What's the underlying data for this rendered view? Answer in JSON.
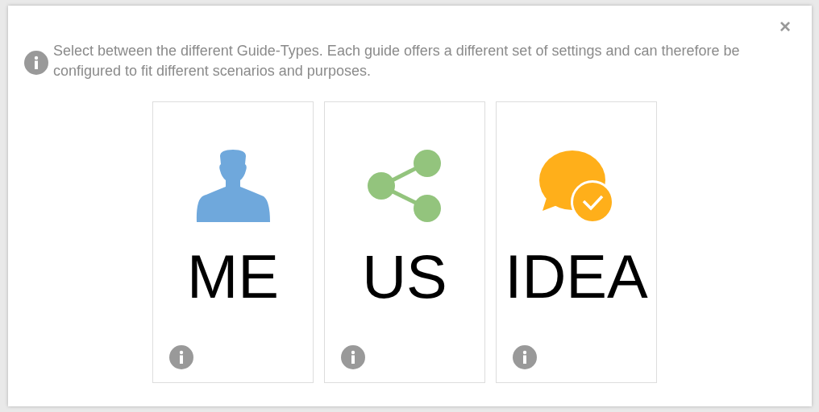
{
  "dialog": {
    "close": "×",
    "intro": "Select between the different Guide-Types. Each guide offers a different set of settings and can therefore be configured to fit different scenarios and purposes."
  },
  "guides": [
    {
      "kind": "person",
      "label": "ME"
    },
    {
      "kind": "share",
      "label": "US"
    },
    {
      "kind": "idea",
      "label": "IDEA"
    }
  ]
}
